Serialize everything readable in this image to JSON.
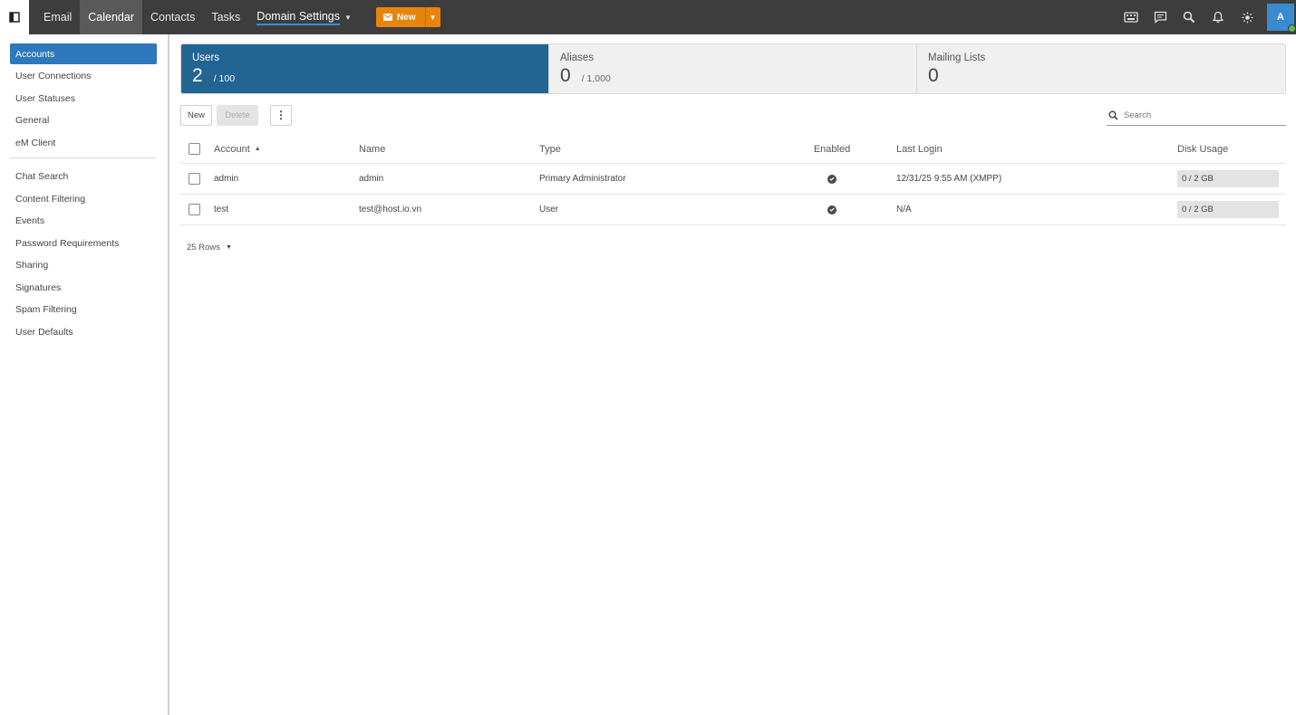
{
  "topnav": {
    "items": [
      {
        "label": "Email"
      },
      {
        "label": "Calendar"
      },
      {
        "label": "Contacts"
      },
      {
        "label": "Tasks"
      },
      {
        "label": "Domain Settings"
      }
    ],
    "new_label": "New",
    "avatar_initial": "A",
    "icons": [
      "sidebar-toggle-icon",
      "keyboard-icon",
      "chat-icon",
      "search-icon",
      "bell-icon",
      "theme-icon"
    ]
  },
  "sidebar": {
    "group1": [
      {
        "label": "Accounts"
      },
      {
        "label": "User Connections"
      },
      {
        "label": "User Statuses"
      },
      {
        "label": "General"
      },
      {
        "label": "eM Client"
      }
    ],
    "group2": [
      {
        "label": "Chat Search"
      },
      {
        "label": "Content Filtering"
      },
      {
        "label": "Events"
      },
      {
        "label": "Password Requirements"
      },
      {
        "label": "Sharing"
      },
      {
        "label": "Signatures"
      },
      {
        "label": "Spam Filtering"
      },
      {
        "label": "User Defaults"
      }
    ]
  },
  "cards": [
    {
      "title": "Users",
      "count": "2",
      "limit": "/ 100"
    },
    {
      "title": "Aliases",
      "count": "0",
      "limit": "/ 1,000"
    },
    {
      "title": "Mailing Lists",
      "count": "0",
      "limit": ""
    }
  ],
  "toolbar": {
    "new_label": "New",
    "delete_label": "Delete",
    "more_label": "⋮",
    "search_placeholder": "Search"
  },
  "table": {
    "headers": {
      "account": "Account",
      "name": "Name",
      "type": "Type",
      "enabled": "Enabled",
      "last_login": "Last Login",
      "disk_usage": "Disk Usage"
    },
    "rows": [
      {
        "account": "admin",
        "name": "admin",
        "type": "Primary Administrator",
        "enabled": true,
        "last_login": "12/31/25 9:55 AM (XMPP)",
        "disk_usage": "0 / 2 GB",
        "disk_fraction": 0
      },
      {
        "account": "test",
        "name": "test@host.io.vn",
        "type": "User",
        "enabled": true,
        "last_login": "N/A",
        "disk_usage": "0 / 2 GB",
        "disk_fraction": 0
      }
    ]
  },
  "rows_per_page": "25 Rows",
  "colors": {
    "topbar": "#3d3d3d",
    "accent": "#2e78bd",
    "card_active": "#226593",
    "new_button": "#e8830c",
    "online": "#5cb85c"
  }
}
